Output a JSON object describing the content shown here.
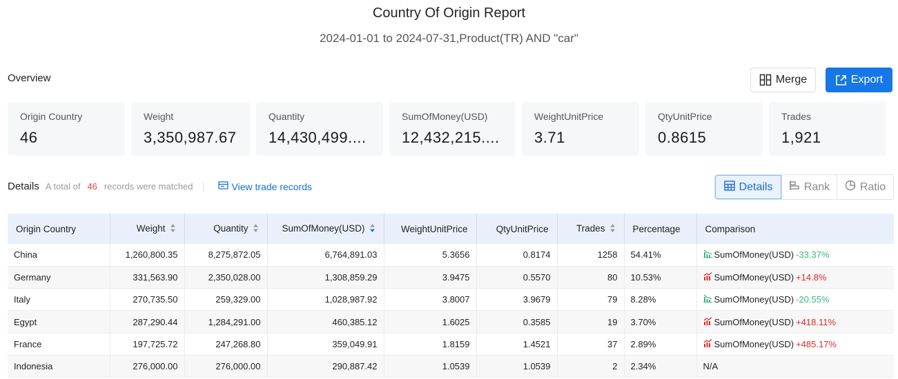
{
  "header": {
    "title": "Country Of Origin Report",
    "subtitle": "2024-01-01 to 2024-07-31,Product(TR) AND \"car\""
  },
  "overview": {
    "label": "Overview",
    "merge_label": "Merge",
    "export_label": "Export",
    "cards": [
      {
        "label": "Origin Country",
        "value": "46"
      },
      {
        "label": "Weight",
        "value": "3,350,987.67"
      },
      {
        "label": "Quantity",
        "value": "14,430,499...."
      },
      {
        "label": "SumOfMoney(USD)",
        "value": "12,432,215...."
      },
      {
        "label": "WeightUnitPrice",
        "value": "3.71"
      },
      {
        "label": "QtyUnitPrice",
        "value": "0.8615"
      },
      {
        "label": "Trades",
        "value": "1,921"
      }
    ]
  },
  "details": {
    "title": "Details",
    "prefix": "A total of",
    "count": "46",
    "suffix": "records were matched",
    "view_trade_records": "View trade records",
    "views": [
      {
        "label": "Details",
        "icon": "table-icon",
        "active": true
      },
      {
        "label": "Rank",
        "icon": "bar-rank-icon",
        "active": false
      },
      {
        "label": "Ratio",
        "icon": "pie-chart-icon",
        "active": false
      }
    ]
  },
  "table": {
    "columns": [
      {
        "label": "Origin Country",
        "sortable": false
      },
      {
        "label": "Weight",
        "sortable": true
      },
      {
        "label": "Quantity",
        "sortable": true
      },
      {
        "label": "SumOfMoney(USD)",
        "sortable": true,
        "sorted": "desc"
      },
      {
        "label": "WeightUnitPrice",
        "sortable": false
      },
      {
        "label": "QtyUnitPrice",
        "sortable": false
      },
      {
        "label": "Trades",
        "sortable": true
      },
      {
        "label": "Percentage",
        "sortable": false
      },
      {
        "label": "Comparison",
        "sortable": false
      }
    ],
    "rows": [
      {
        "country": "China",
        "weight": "1,260,800.35",
        "quantity": "8,275,872.05",
        "sum": "6,764,891.03",
        "wup": "5.3656",
        "qup": "0.8174",
        "trades": "1258",
        "pct": "54.41%",
        "cmp_label": "SumOfMoney(USD)",
        "cmp_value": "-33.37%",
        "trend": "down"
      },
      {
        "country": "Germany",
        "weight": "331,563.90",
        "quantity": "2,350,028.00",
        "sum": "1,308,859.29",
        "wup": "3.9475",
        "qup": "0.5570",
        "trades": "80",
        "pct": "10.53%",
        "cmp_label": "SumOfMoney(USD)",
        "cmp_value": "+14.8%",
        "trend": "up"
      },
      {
        "country": "Italy",
        "weight": "270,735.50",
        "quantity": "259,329.00",
        "sum": "1,028,987.92",
        "wup": "3.8007",
        "qup": "3.9679",
        "trades": "79",
        "pct": "8.28%",
        "cmp_label": "SumOfMoney(USD)",
        "cmp_value": "-20.55%",
        "trend": "down"
      },
      {
        "country": "Egypt",
        "weight": "287,290.44",
        "quantity": "1,284,291.00",
        "sum": "460,385.12",
        "wup": "1.6025",
        "qup": "0.3585",
        "trades": "19",
        "pct": "3.70%",
        "cmp_label": "SumOfMoney(USD)",
        "cmp_value": "+418.11%",
        "trend": "up"
      },
      {
        "country": "France",
        "weight": "197,725.72",
        "quantity": "247,268.80",
        "sum": "359,049.91",
        "wup": "1.8159",
        "qup": "1.4521",
        "trades": "37",
        "pct": "2.89%",
        "cmp_label": "SumOfMoney(USD)",
        "cmp_value": "+485.17%",
        "trend": "up"
      },
      {
        "country": "Indonesia",
        "weight": "276,000.00",
        "quantity": "276,000.00",
        "sum": "290,887.42",
        "wup": "1.0539",
        "qup": "1.0539",
        "trades": "2",
        "pct": "2.34%",
        "cmp_label": "",
        "cmp_value": "N/A",
        "trend": "none"
      }
    ]
  },
  "colors": {
    "accent": "#1677e8",
    "up": "#e02828",
    "down": "#3cb878",
    "count": "#e5473e"
  }
}
